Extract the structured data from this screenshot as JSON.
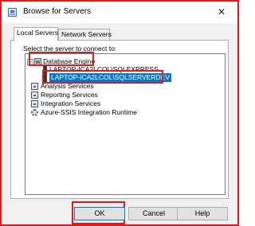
{
  "window": {
    "title": "Browse for Servers",
    "close_glyph": "✕"
  },
  "tabs": [
    {
      "label": "Local Servers",
      "active": true
    },
    {
      "label": "Network Servers",
      "active": false
    }
  ],
  "panel": {
    "prompt": "Select the server to connect to:"
  },
  "tree": {
    "expander_glyph": "−",
    "items": [
      {
        "label": "Database Engine",
        "icon": "database-engine-icon"
      },
      {
        "label": "LAPTOP-ICA2LCOL\\SQLEXPRESS",
        "icon": "server-icon"
      },
      {
        "label": "LAPTOP-ICA2LCOL\\SQLSERVERDEV",
        "icon": "server-icon",
        "selected": true
      },
      {
        "label": "Analysis Services",
        "icon": "analysis-services-icon"
      },
      {
        "label": "Reporting Services",
        "icon": "reporting-services-icon"
      },
      {
        "label": "Integration Services",
        "icon": "integration-services-icon"
      },
      {
        "label": "Azure-SSIS Integration Runtime",
        "icon": "gear-icon"
      }
    ]
  },
  "buttons": {
    "ok": "OK",
    "cancel": "Cancel",
    "help": "Help"
  },
  "colors": {
    "highlight": "#e01919",
    "selection": "#0078d7"
  }
}
